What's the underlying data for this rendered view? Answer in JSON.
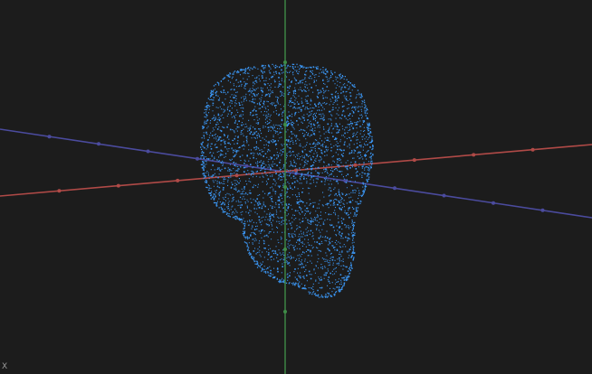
{
  "viewport": {
    "background_color": "#1c1c1c",
    "view_mode": "3d-point-cloud"
  },
  "model": {
    "type": "point-cloud",
    "subject": "skull",
    "point_color": "#3a93ee"
  },
  "axes": {
    "x_color": "#b04a47",
    "y_color": "#3f8d48",
    "z_color": "#4b4b9e",
    "corner_label": "X"
  }
}
